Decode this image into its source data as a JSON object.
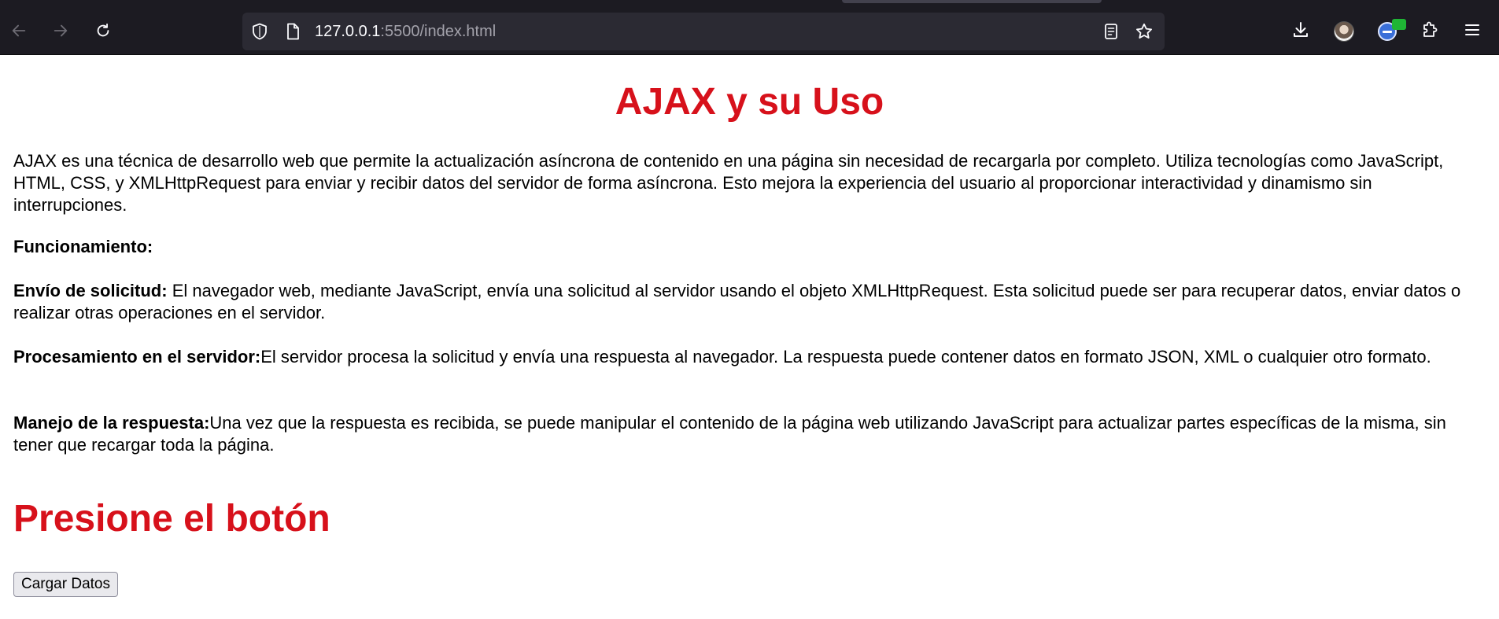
{
  "browser": {
    "url_host": "127.0.0.1",
    "url_rest": ":5500/index.html",
    "icons": [
      "back-icon",
      "forward-icon",
      "reload-icon",
      "shield-icon",
      "page-icon",
      "reader-view-icon",
      "bookmark-star-icon",
      "download-icon",
      "account-avatar-icon",
      "extension-globe-icon",
      "extensions-puzzle-icon",
      "menu-icon"
    ]
  },
  "page": {
    "title": "AJAX y su Uso",
    "intro": "AJAX es una técnica de desarrollo web que permite la actualización asíncrona de contenido en una página sin necesidad de recargarla por completo. Utiliza tecnologías como JavaScript, HTML, CSS, y XMLHttpRequest para enviar y recibir datos del servidor de forma asíncrona. Esto mejora la experiencia del usuario al proporcionar interactividad y dinamismo sin interrupciones.",
    "funcionamiento_label": "Funcionamiento:",
    "steps": [
      {
        "label": "Envío de solicitud:",
        "text": " El navegador web, mediante JavaScript, envía una solicitud al servidor usando el objeto XMLHttpRequest. Esta solicitud puede ser para recuperar datos, enviar datos o realizar otras operaciones en el servidor."
      },
      {
        "label": "Procesamiento en el servidor:",
        "text": "El servidor procesa la solicitud y envía una respuesta al navegador. La respuesta puede contener datos en formato JSON, XML o cualquier otro formato."
      },
      {
        "label": "Manejo de la respuesta:",
        "text": "Una vez que la respuesta es recibida, se puede manipular el contenido de la página web utilizando JavaScript para actualizar partes específicas de la misma, sin tener que recargar toda la página."
      }
    ],
    "subtitle": "Presione el botón",
    "button_label": "Cargar Datos"
  },
  "colors": {
    "heading_red": "#d7111b",
    "chrome_bg": "#1c1b22",
    "urlbar_bg": "#2b2a33"
  }
}
